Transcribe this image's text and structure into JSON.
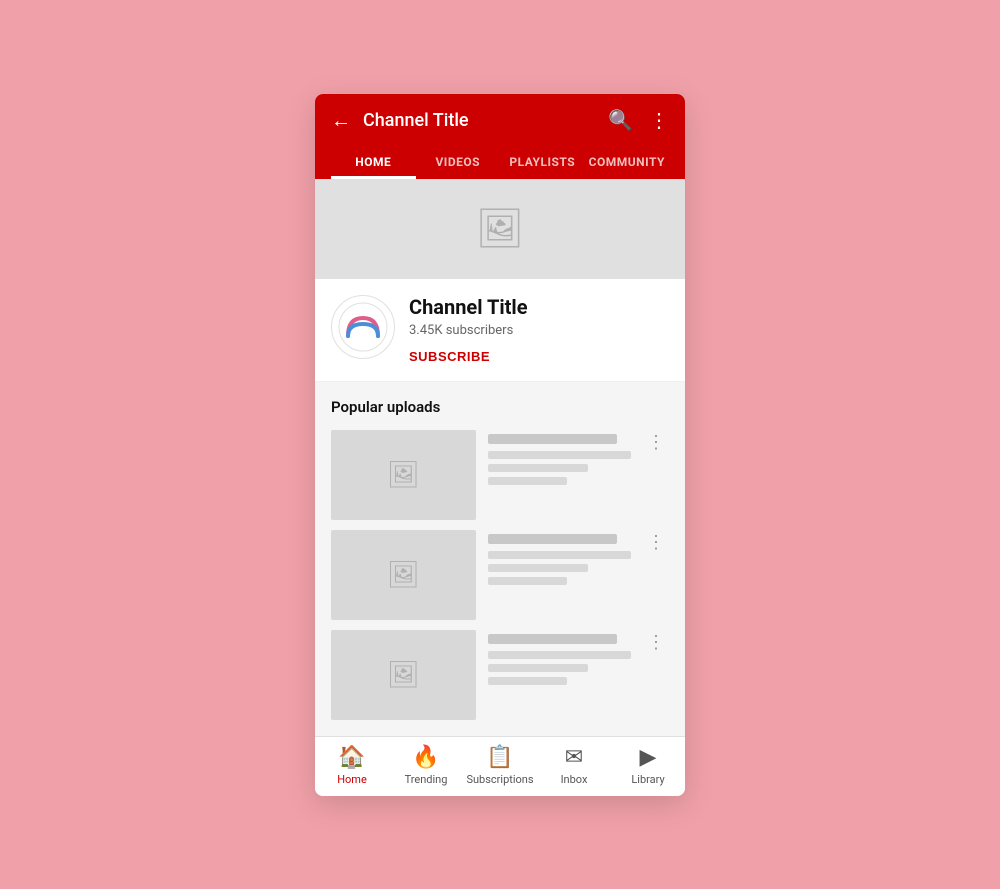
{
  "header": {
    "back_label": "←",
    "channel_title": "Channel Title",
    "search_icon": "search-icon",
    "more_icon": "more-vert-icon"
  },
  "tabs": [
    {
      "label": "HOME",
      "active": true
    },
    {
      "label": "VIDEOS",
      "active": false
    },
    {
      "label": "PLAYLISTS",
      "active": false
    },
    {
      "label": "COMMUNITY",
      "active": false
    }
  ],
  "channel_info": {
    "name": "Channel Title",
    "subscribers": "3.45K subscribers",
    "subscribe_label": "SUBSCRIBE"
  },
  "popular_uploads": {
    "section_title": "Popular uploads",
    "videos": [
      {
        "id": 1
      },
      {
        "id": 2
      },
      {
        "id": 3
      }
    ]
  },
  "bottom_nav": [
    {
      "label": "Home",
      "active": true,
      "icon": "🏠"
    },
    {
      "label": "Trending",
      "active": false,
      "icon": "🔥"
    },
    {
      "label": "Subscriptions",
      "active": false,
      "icon": "📋"
    },
    {
      "label": "Inbox",
      "active": false,
      "icon": "✉"
    },
    {
      "label": "Library",
      "active": false,
      "icon": "▶"
    }
  ]
}
